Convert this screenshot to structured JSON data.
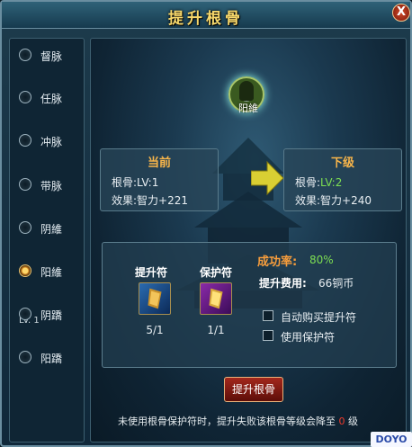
{
  "window": {
    "title": "提升根骨",
    "close_glyph": "X"
  },
  "sidebar": {
    "items": [
      {
        "label": "督脉",
        "selected": false
      },
      {
        "label": "任脉",
        "selected": false
      },
      {
        "label": "冲脉",
        "selected": false
      },
      {
        "label": "带脉",
        "selected": false
      },
      {
        "label": "阴維",
        "selected": false
      },
      {
        "label": "阳維",
        "selected": true
      },
      {
        "label": "阴蹻",
        "selected": false
      },
      {
        "label": "阳蹻",
        "selected": false
      }
    ],
    "selected_level": "LV. 1"
  },
  "emblem": {
    "label": "阳維",
    "icon": "meridian-emblem-icon"
  },
  "current": {
    "heading": "当前",
    "level_label": "根骨:",
    "level_value": "LV:1",
    "effect_label": "效果:",
    "effect_value": "智力+221"
  },
  "next": {
    "heading": "下级",
    "level_label": "根骨:",
    "level_value": "LV:2",
    "effect_label": "效果:",
    "effect_value": "智力+240"
  },
  "items": {
    "upgrade_charm": {
      "title": "提升符",
      "count": "5/1",
      "icon": "upgrade-charm-icon"
    },
    "protect_charm": {
      "title": "保护符",
      "count": "1/1",
      "icon": "protect-charm-icon"
    }
  },
  "stats": {
    "rate_label": "成功率:",
    "rate_value": "80%",
    "cost_label": "提升费用:",
    "cost_value": "66铜币"
  },
  "options": {
    "auto_buy": "自动购买提升符",
    "use_protect": "使用保护符"
  },
  "actions": {
    "upgrade": "提升根骨"
  },
  "footer": {
    "note_before": "未使用根骨保护符时，提升失败该根骨等级会降至",
    "note_value": "0",
    "note_after": "级"
  },
  "watermark": "DOYO",
  "colors": {
    "accent": "#f8b54a",
    "green": "#7dde52",
    "gold": "#f7d86b",
    "button_red": "#a3281c"
  }
}
